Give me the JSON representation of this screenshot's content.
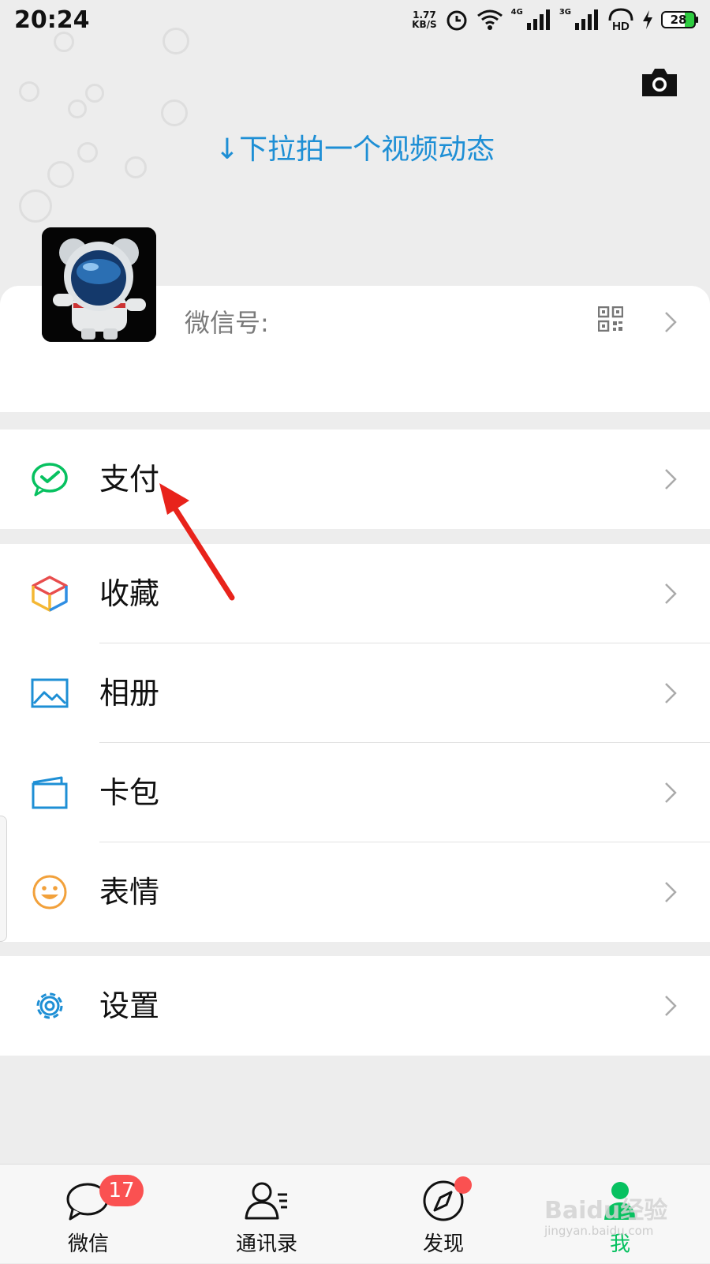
{
  "status_bar": {
    "time": "20:24",
    "net_speed_value": "1.77",
    "net_speed_unit": "KB/S",
    "signal_1": "4G",
    "signal_2": "3G",
    "hd": "HD",
    "battery": "28"
  },
  "header": {
    "pull_hint": "↓下拉拍一个视频动态",
    "camera_icon": "camera-icon"
  },
  "profile": {
    "wechat_id_label": "微信号:",
    "qr_icon": "qr-code-icon"
  },
  "menu": {
    "pay": {
      "label": "支付",
      "icon": "wechat-pay-icon",
      "color": "#07c160"
    },
    "favorites": {
      "label": "收藏",
      "icon": "cube-icon"
    },
    "album": {
      "label": "相册",
      "icon": "picture-icon",
      "color": "#1e8fd5"
    },
    "cards": {
      "label": "卡包",
      "icon": "card-wallet-icon",
      "color": "#1e8fd5"
    },
    "stickers": {
      "label": "表情",
      "icon": "smiley-icon",
      "color": "#f2a13b"
    },
    "settings": {
      "label": "设置",
      "icon": "gear-icon",
      "color": "#1e8fd5"
    }
  },
  "tabs": [
    {
      "label": "微信",
      "icon": "chat-bubble-icon",
      "badge": "17"
    },
    {
      "label": "通讯录",
      "icon": "contacts-icon"
    },
    {
      "label": "发现",
      "icon": "compass-icon"
    },
    {
      "label": "我",
      "icon": "me-icon",
      "active": true,
      "color": "#07c160"
    }
  ],
  "watermark": {
    "text": "Baidu经验",
    "sub": "jingyan.baidu.com"
  },
  "colors": {
    "accent": "#07c160",
    "link": "#1e8fd5",
    "badge": "#fa5151",
    "annotation_arrow": "#e8231b"
  }
}
